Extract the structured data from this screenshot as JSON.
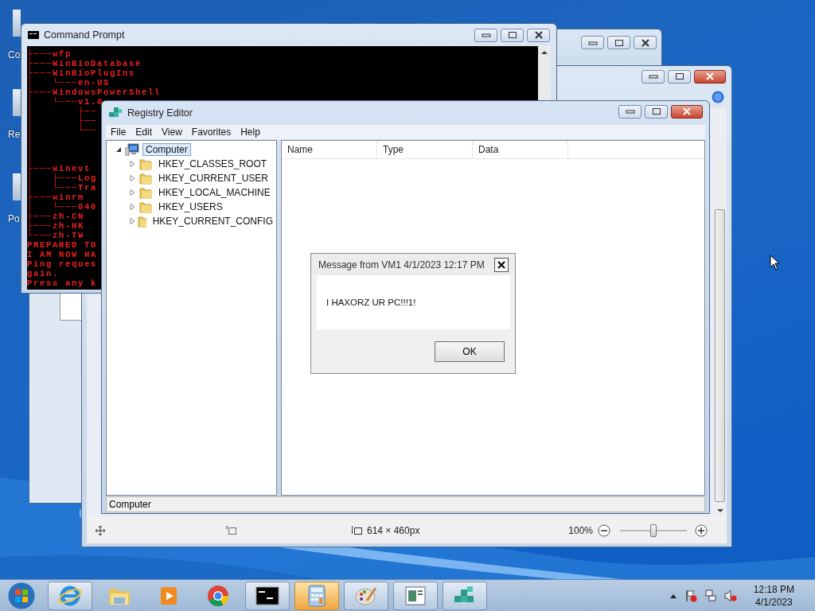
{
  "desktop": {
    "icons": [
      {
        "label": "Co"
      },
      {
        "label": "Re"
      },
      {
        "label": "Po"
      }
    ]
  },
  "command_prompt": {
    "title": "Command Prompt",
    "lines": [
      "├───wfp",
      "├───WinBioDatabase",
      "├───WinBioPlugIns",
      "│   └───en-US",
      "├───WindowsPowerShell",
      "│   └───v1.0",
      "│       ├──",
      "│       ├──",
      "│       └──",
      "│",
      "│",
      "│",
      "├───winevt",
      "│   ├───Log",
      "│   └───Tra",
      "├───winrm",
      "│   └───040",
      "├───zh-CN",
      "├───zh-HK",
      "└───zh-TW",
      "PREPARED TO",
      "I AM NOW HA",
      "Ping reques",
      "gain.",
      "Press any k"
    ]
  },
  "paint": {
    "status_bar": {
      "dimensions": "614 × 460px",
      "zoom": "100%",
      "zoom_slider": {
        "level": 0.5
      }
    }
  },
  "registry_editor": {
    "title": "Registry Editor",
    "menu": [
      "File",
      "Edit",
      "View",
      "Favorites",
      "Help"
    ],
    "tree": {
      "label": "Computer",
      "expanded": true,
      "selected": true,
      "children": [
        {
          "label": "HKEY_CLASSES_ROOT",
          "expanded": false,
          "selected": false
        },
        {
          "label": "HKEY_CURRENT_USER",
          "expanded": false,
          "selected": false
        },
        {
          "label": "HKEY_LOCAL_MACHINE",
          "expanded": false,
          "selected": false
        },
        {
          "label": "HKEY_USERS",
          "expanded": false,
          "selected": false
        },
        {
          "label": "HKEY_CURRENT_CONFIG",
          "expanded": false,
          "selected": false
        }
      ]
    },
    "columns": [
      "Name",
      "Type",
      "Data"
    ],
    "status_bar": "Computer"
  },
  "message": {
    "title": "Message from VM1 4/1/2023 12:17 PM",
    "text": "I HAXORZ UR PC!!!1!",
    "button": "OK"
  },
  "taskbar": {
    "items": [
      {
        "kind": "browser",
        "running": true,
        "selected": false
      },
      {
        "kind": "folder",
        "running": false,
        "selected": false
      },
      {
        "kind": "media",
        "running": false,
        "selected": false
      },
      {
        "kind": "chrome",
        "running": false,
        "selected": false
      },
      {
        "kind": "console",
        "running": true,
        "selected": false
      },
      {
        "kind": "calculator",
        "running": true,
        "selected": true
      },
      {
        "kind": "paint",
        "running": true,
        "selected": false
      },
      {
        "kind": "document",
        "running": true,
        "selected": false
      },
      {
        "kind": "registry",
        "running": true,
        "selected": false
      }
    ],
    "clock": {
      "time": "12:18 PM",
      "date": "4/1/2023"
    }
  }
}
